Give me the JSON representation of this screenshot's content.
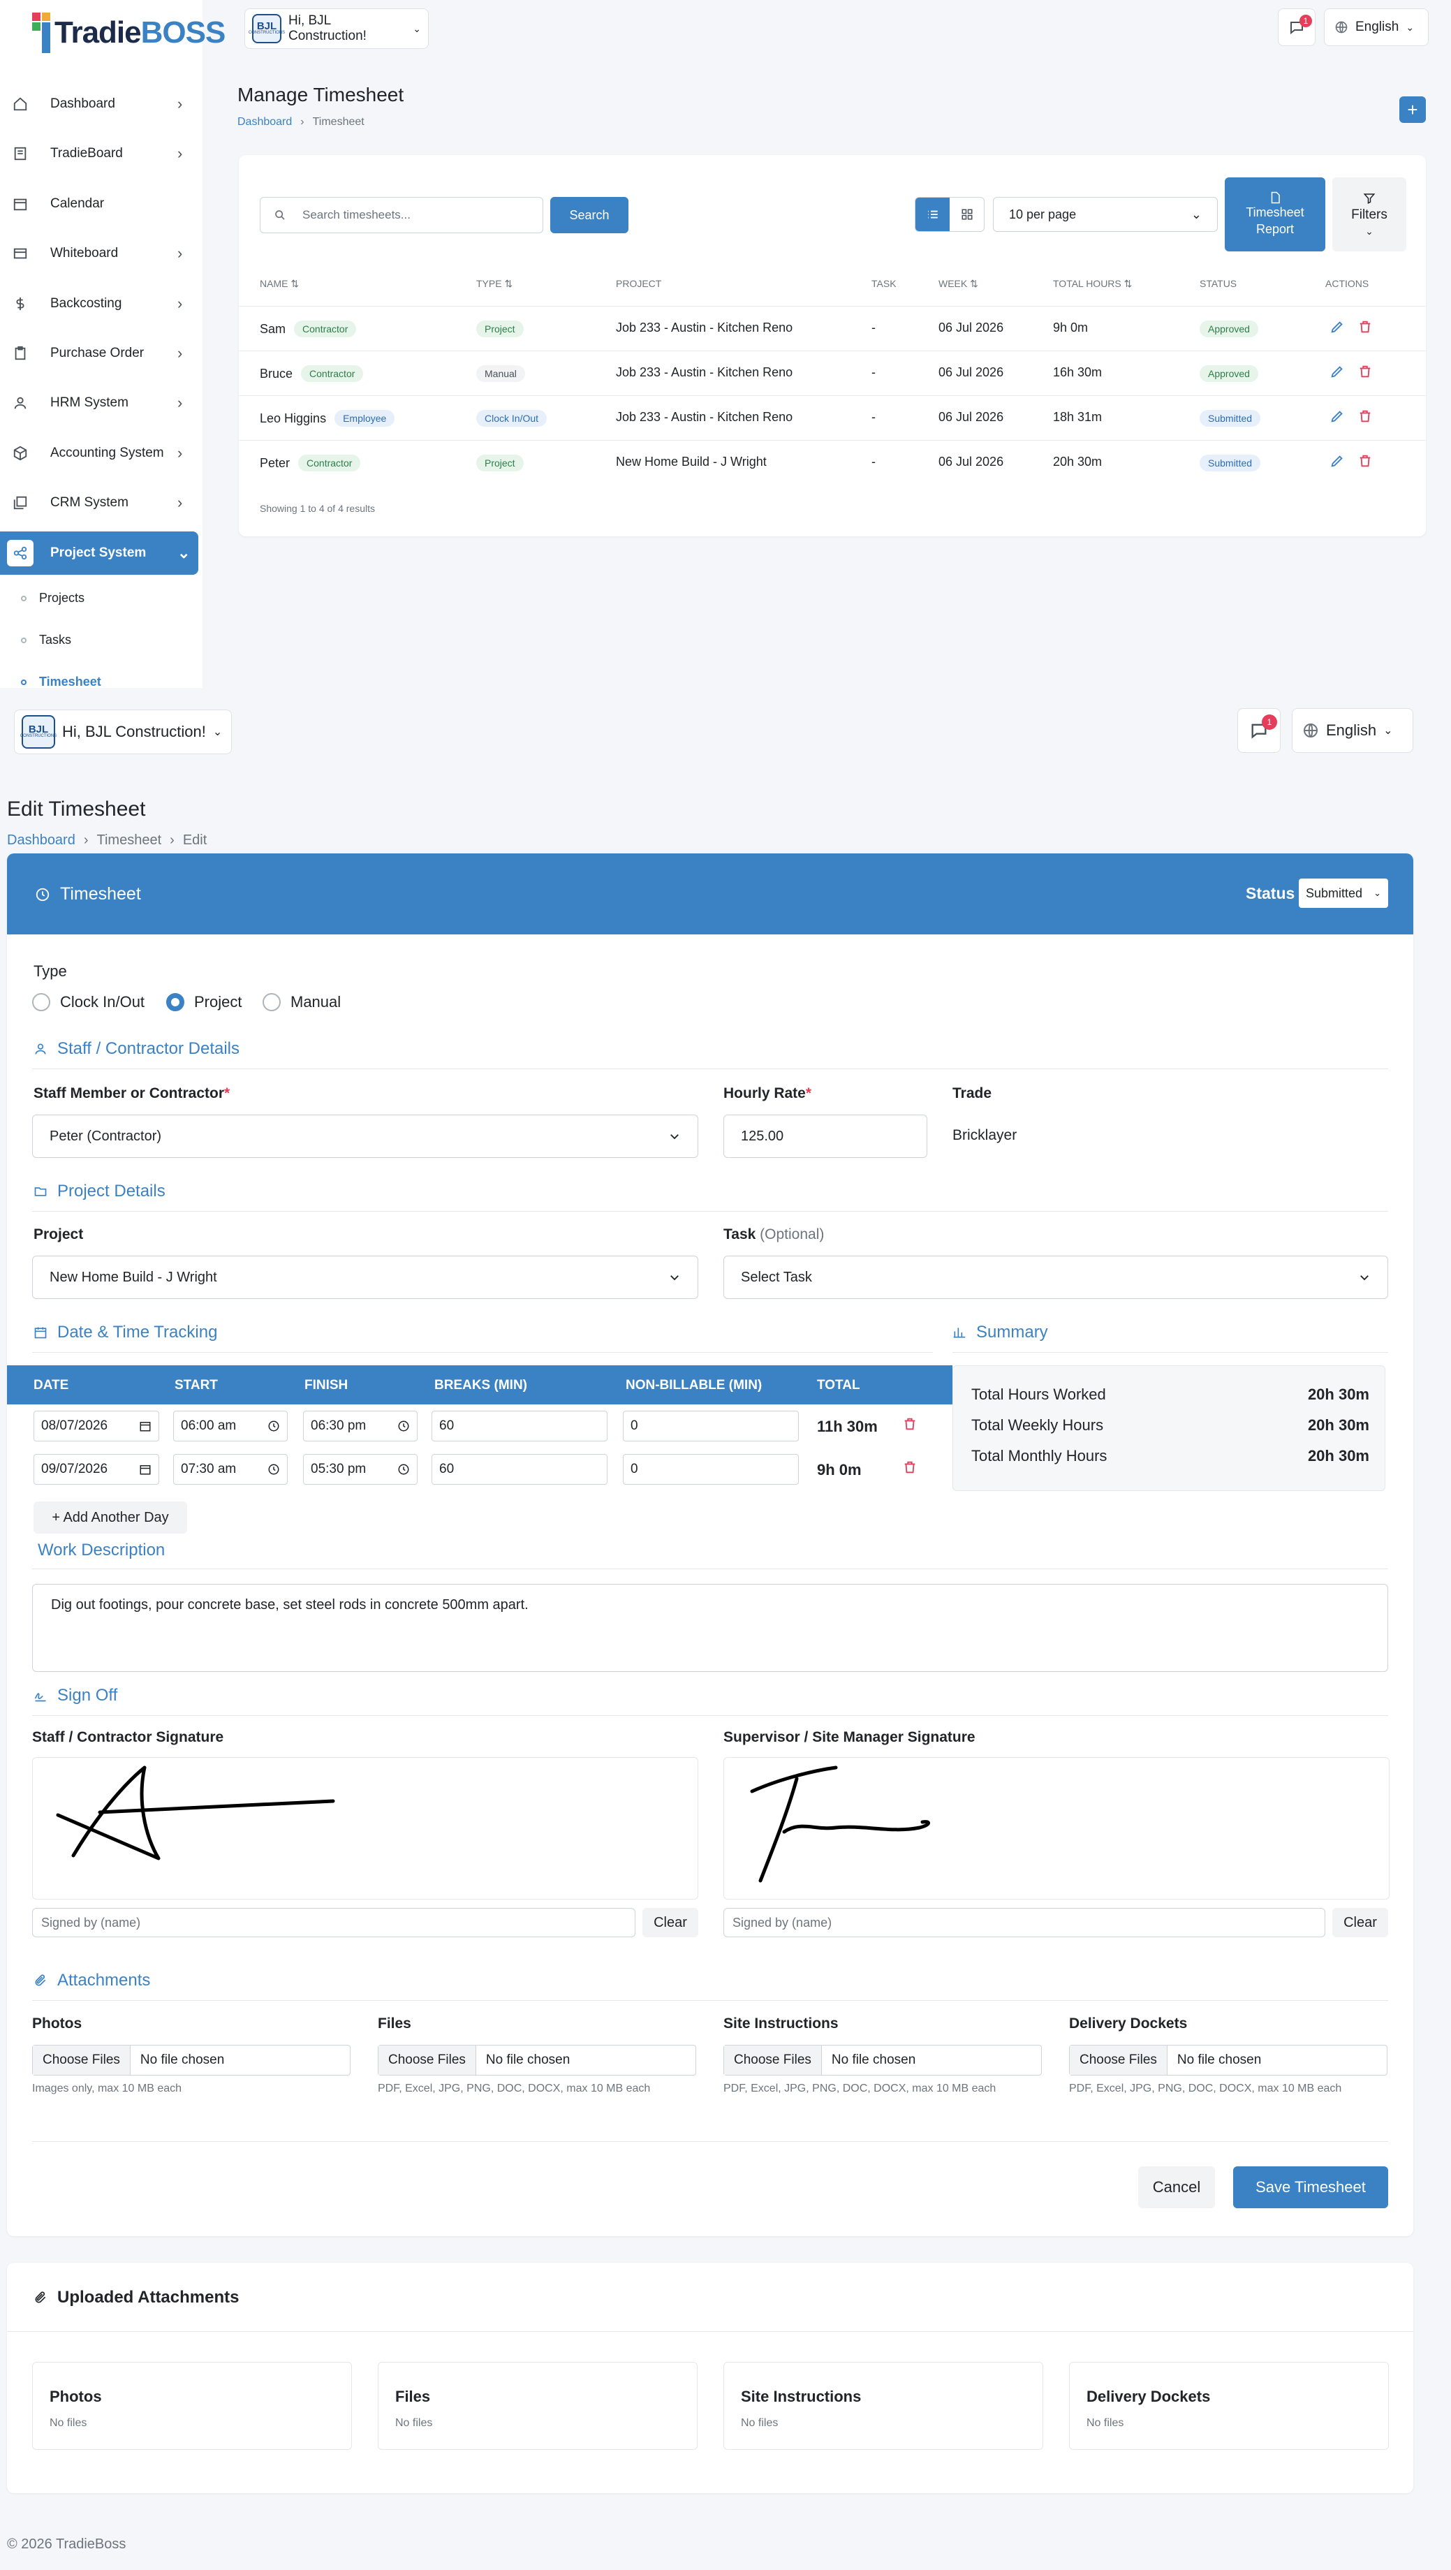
{
  "app": {
    "logo_text_1": "Tradie",
    "logo_text_2": "BOSS",
    "company_label": "Hi, BJL Construction!",
    "company_logo_text": "BJL",
    "company_logo_sub": "CONSTRUCTIONS",
    "language": "English",
    "notification_count": "1"
  },
  "colors": {
    "primary": "#3b82c4",
    "danger": "#e53e5a"
  },
  "sidebar": {
    "items": [
      {
        "label": "Dashboard",
        "icon": "home-icon",
        "chevron": true
      },
      {
        "label": "TradieBoard",
        "icon": "board-icon",
        "chevron": true
      },
      {
        "label": "Calendar",
        "icon": "calendar-icon",
        "chevron": false
      },
      {
        "label": "Whiteboard",
        "icon": "whiteboard-icon",
        "chevron": true
      },
      {
        "label": "Backcosting",
        "icon": "dollar-icon",
        "chevron": true
      },
      {
        "label": "Purchase Order",
        "icon": "clipboard-icon",
        "chevron": true
      },
      {
        "label": "HRM System",
        "icon": "user-icon",
        "chevron": true
      },
      {
        "label": "Accounting System",
        "icon": "box-icon",
        "chevron": true
      },
      {
        "label": "CRM System",
        "icon": "layers-icon",
        "chevron": true
      },
      {
        "label": "Project System",
        "icon": "share-icon",
        "chevron": true,
        "active": true
      }
    ],
    "sub_items": [
      {
        "label": "Projects"
      },
      {
        "label": "Tasks"
      },
      {
        "label": "Timesheet",
        "active": true
      }
    ]
  },
  "manage": {
    "title": "Manage Timesheet",
    "breadcrumb": [
      "Dashboard",
      "Timesheet"
    ],
    "search_placeholder": "Search timesheets...",
    "search_button": "Search",
    "per_page": "10 per page",
    "report_button_1": "Timesheet",
    "report_button_2": "Report",
    "filters_button": "Filters",
    "columns": [
      "NAME",
      "TYPE",
      "PROJECT",
      "TASK",
      "WEEK",
      "TOTAL HOURS",
      "STATUS",
      "ACTIONS"
    ],
    "rows": [
      {
        "name": "Sam",
        "role": "Contractor",
        "type": "Project",
        "project": "Job 233 - Austin - Kitchen Reno",
        "task": "-",
        "week": "06 Jul 2026",
        "hours": "9h 0m",
        "status": "Approved"
      },
      {
        "name": "Bruce",
        "role": "Contractor",
        "type": "Manual",
        "project": "Job 233 - Austin - Kitchen Reno",
        "task": "-",
        "week": "06 Jul 2026",
        "hours": "16h 30m",
        "status": "Approved"
      },
      {
        "name": "Leo Higgins",
        "role": "Employee",
        "type": "Clock In/Out",
        "project": "Job 233 - Austin - Kitchen Reno",
        "task": "-",
        "week": "06 Jul 2026",
        "hours": "18h 31m",
        "status": "Submitted"
      },
      {
        "name": "Peter",
        "role": "Contractor",
        "type": "Project",
        "project": "New Home Build - J Wright",
        "task": "-",
        "week": "06 Jul 2026",
        "hours": "20h 30m",
        "status": "Submitted"
      }
    ],
    "footer": "Showing 1 to 4 of 4 results"
  },
  "edit": {
    "title": "Edit Timesheet",
    "breadcrumb": [
      "Dashboard",
      "Timesheet",
      "Edit"
    ],
    "panel_title": "Timesheet",
    "status_label": "Status",
    "status_value": "Submitted",
    "type_label": "Type",
    "type_options": [
      {
        "label": "Clock In/Out",
        "checked": false
      },
      {
        "label": "Project",
        "checked": true
      },
      {
        "label": "Manual",
        "checked": false
      }
    ],
    "staff_section": "Staff / Contractor Details",
    "staff_label": "Staff Member or Contractor",
    "staff_value": "Peter (Contractor)",
    "rate_label": "Hourly Rate",
    "rate_value": "125.00",
    "trade_label": "Trade",
    "trade_value": "Bricklayer",
    "project_section": "Project Details",
    "project_label": "Project",
    "project_value": "New Home Build - J Wright",
    "task_label": "Task",
    "task_optional": "(Optional)",
    "task_value": "Select Task",
    "dt_section": "Date & Time Tracking",
    "dt_columns": [
      "DATE",
      "START",
      "FINISH",
      "BREAKS (MIN)",
      "NON-BILLABLE (MIN)",
      "TOTAL"
    ],
    "dt_rows": [
      {
        "date": "08/07/2026",
        "start": "06:00 am",
        "finish": "06:30 pm",
        "breaks": "60",
        "nonbill": "0",
        "total": "11h 30m"
      },
      {
        "date": "09/07/2026",
        "start": "07:30 am",
        "finish": "05:30 pm",
        "breaks": "60",
        "nonbill": "0",
        "total": "9h 0m"
      }
    ],
    "add_day": "+ Add Another Day",
    "summary_section": "Summary",
    "summary": [
      {
        "label": "Total Hours Worked",
        "value": "20h 30m"
      },
      {
        "label": "Total Weekly Hours",
        "value": "20h 30m"
      },
      {
        "label": "Total Monthly Hours",
        "value": "20h 30m"
      }
    ],
    "work_section": "Work Description",
    "work_value": "Dig out footings, pour concrete base, set steel rods in concrete 500mm apart.",
    "signoff_section": "Sign Off",
    "staff_sig_label": "Staff / Contractor Signature",
    "super_sig_label": "Supervisor / Site Manager Signature",
    "signed_by_placeholder": "Signed by (name)",
    "clear_button": "Clear",
    "attachments_section": "Attachments",
    "attachments": [
      {
        "label": "Photos",
        "hint": "Images only, max 10 MB each"
      },
      {
        "label": "Files",
        "hint": "PDF, Excel, JPG, PNG, DOC, DOCX, max 10 MB each"
      },
      {
        "label": "Site Instructions",
        "hint": "PDF, Excel, JPG, PNG, DOC, DOCX, max 10 MB each"
      },
      {
        "label": "Delivery Dockets",
        "hint": "PDF, Excel, JPG, PNG, DOC, DOCX, max 10 MB each"
      }
    ],
    "choose_files": "Choose Files",
    "no_file": "No file chosen",
    "cancel_button": "Cancel",
    "save_button": "Save Timesheet",
    "uploaded_title": "Uploaded Attachments",
    "uploaded": [
      {
        "label": "Photos",
        "value": "No files"
      },
      {
        "label": "Files",
        "value": "No files"
      },
      {
        "label": "Site Instructions",
        "value": "No files"
      },
      {
        "label": "Delivery Dockets",
        "value": "No files"
      }
    ],
    "footer": "© 2026 TradieBoss"
  }
}
